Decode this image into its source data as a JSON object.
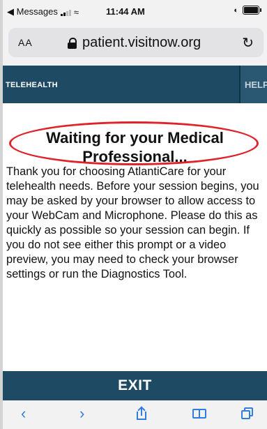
{
  "status_bar": {
    "back_app": "◀ Messages",
    "time": "11:44 AM"
  },
  "address_bar": {
    "text_size": "AA",
    "url": "patient.visitnow.org"
  },
  "nav": {
    "brand": "TELEHEALTH",
    "help": "HELP"
  },
  "main": {
    "heading": "Waiting for your Medical Professional...",
    "message": "Thank you for choosing AtlantiCare for your telehealth needs. Before your session begins, you may be asked by your browser to allow access to your WebCam and Microphone. Please do this as quickly as possible so your session can begin. If you do not see either this prompt or a video preview, you may need to check your browser settings or run the Diagnostics Tool.",
    "exit_label": "EXIT"
  },
  "toolbar": {
    "back": "‹",
    "forward": "›"
  },
  "colors": {
    "brand_navy": "#1e4a63",
    "annotation_red": "#e0232b",
    "ios_blue": "#2f7de1"
  }
}
